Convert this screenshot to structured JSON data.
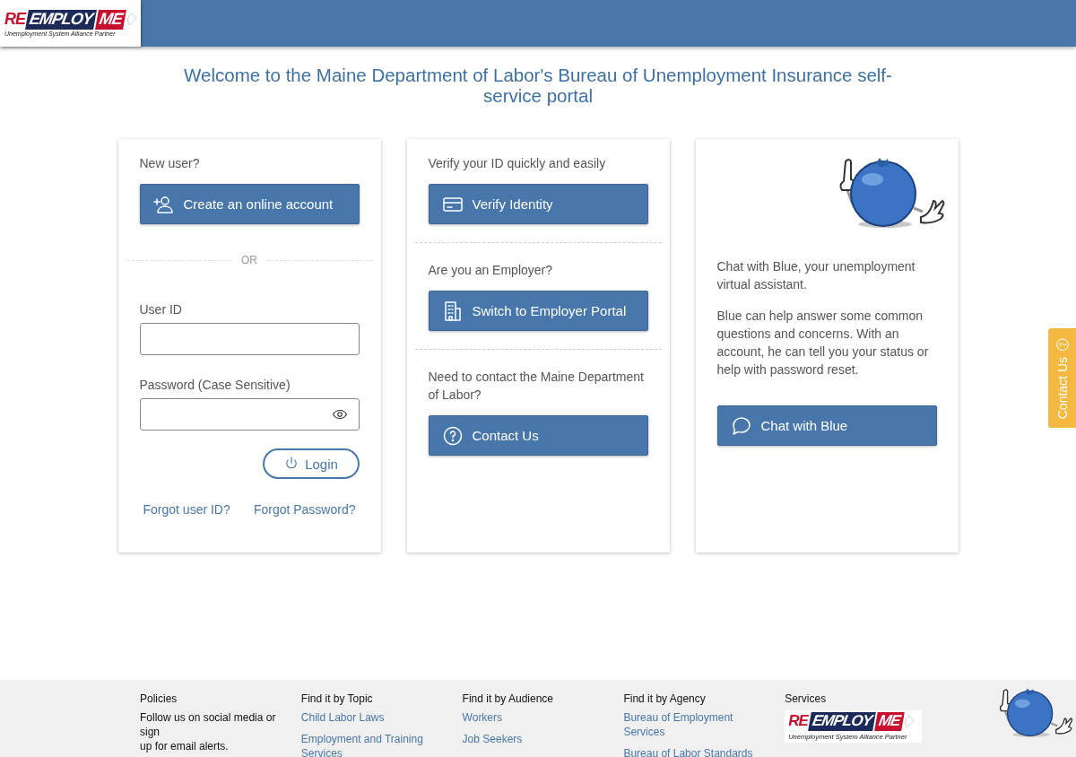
{
  "header": {
    "logo": {
      "mark_re": "RE",
      "mark_employ": "EMPLOY",
      "mark_me": "ME",
      "tagline": "Unemployment System Alliance Partner"
    }
  },
  "welcome_title": "Welcome to the Maine Department of Labor's Bureau of Unemployment Insurance self-service portal",
  "login_card": {
    "new_user_label": "New user?",
    "create_button": "Create an online account",
    "divider": "OR",
    "fields": [
      {
        "label": "User ID",
        "kind": "text"
      },
      {
        "label": "Password (Case Sensitive)",
        "kind": "password"
      }
    ],
    "login_button": "Login",
    "links": [
      "Forgot user ID?",
      "Forgot Password?"
    ]
  },
  "options_card": {
    "sections": [
      {
        "prompt": "Verify your ID quickly and easily",
        "button": "Verify Identity",
        "kind": "id-card"
      },
      {
        "prompt": "Are you an Employer?",
        "button": "Switch to Employer Portal",
        "kind": "building"
      },
      {
        "prompt": "Need to contact the Maine Department of Labor?",
        "button": "Contact Us",
        "kind": "help"
      }
    ]
  },
  "chat_card": {
    "paragraphs": [
      "Chat with Blue, your unemployment virtual assistant.",
      "Blue can help answer some common questions and concerns. With an account, he can tell you your status or help with password reset."
    ],
    "button": "Chat with Blue"
  },
  "side_tab": {
    "label": "Contact Us"
  },
  "footer": {
    "columns": [
      {
        "heading": "Policies",
        "kind": "text",
        "text": "Follow us on social media or sign\nup for email alerts."
      },
      {
        "heading": "Find it by Topic",
        "kind": "links",
        "links": [
          "Child Labor Laws",
          "Employment and Training Services"
        ]
      },
      {
        "heading": "Find it by Audience",
        "kind": "links",
        "links": [
          "Workers",
          "Job Seekers"
        ]
      },
      {
        "heading": "Find it by Agency",
        "kind": "links",
        "links": [
          "Bureau of Employment Services",
          "Bureau of Labor Standards"
        ]
      },
      {
        "heading": "Services",
        "kind": "logo",
        "logo": {
          "mark_re": "RE",
          "mark_employ": "EMPLOY",
          "mark_me": "ME",
          "tagline": "Unemployment System Alliance Partner"
        }
      }
    ]
  }
}
